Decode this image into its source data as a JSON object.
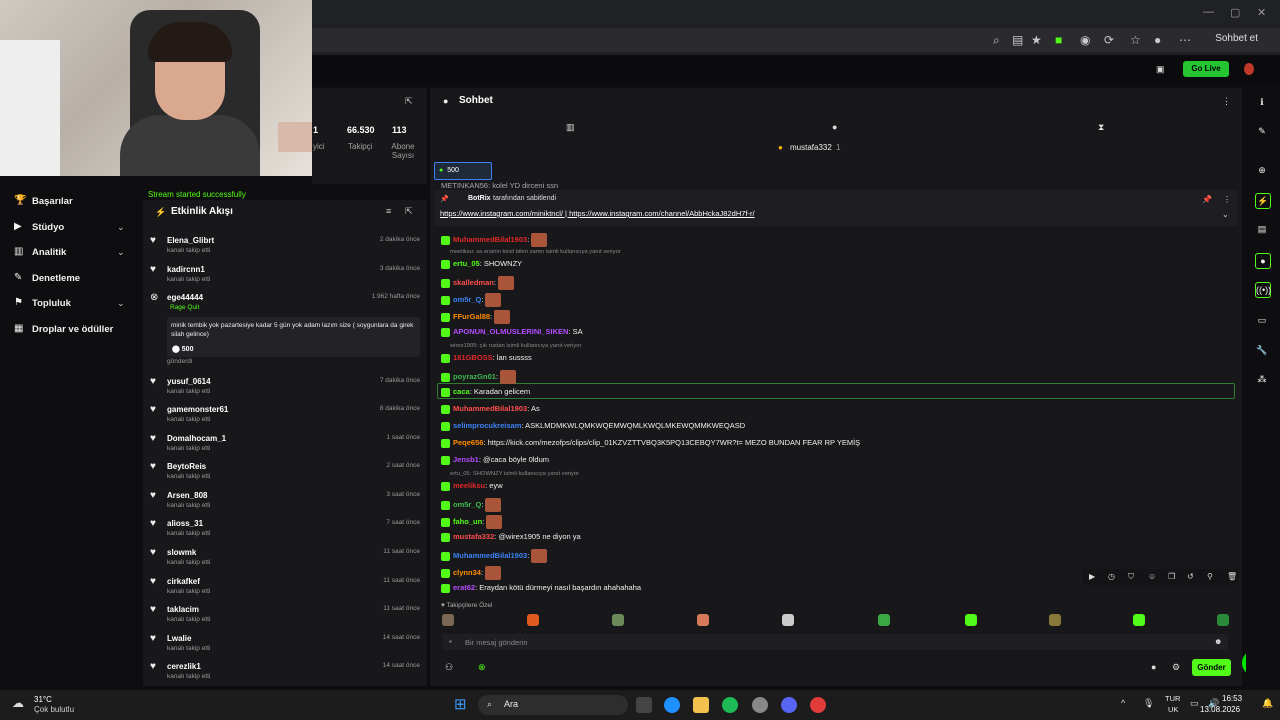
{
  "browser": {
    "sohbet_et": "Sohbet et"
  },
  "header": {
    "go_live": "Go Live"
  },
  "nav": {
    "items": [
      {
        "label": "Başarılar"
      },
      {
        "label": "Stüdyo"
      },
      {
        "label": "Analitik"
      },
      {
        "label": "Denetleme"
      },
      {
        "label": "Topluluk"
      },
      {
        "label": "Droplar ve ödüller"
      }
    ]
  },
  "stats": {
    "followers_value": "66.530",
    "followers_label": "Takipçi",
    "subs_value": "113",
    "subs_label": "Abone Sayısı",
    "viewers_label": "İzleyici"
  },
  "activity": {
    "stream_ok": "Stream started successfully",
    "title": "Etkinlik Akışı",
    "rows": [
      {
        "user": "Elena_Glibrt",
        "sub": "kanalı takip etti",
        "time": "2 dakika önce"
      },
      {
        "user": "kadircnn1",
        "sub": "kanalı takip etti",
        "time": "3 dakika önce"
      },
      {
        "user": "ege44444",
        "sub": "Rage Quit",
        "time": "1.962 hafta önce"
      },
      {
        "user": "yusuf_0614",
        "sub": "kanalı takip etti",
        "time": "7 dakika önce"
      },
      {
        "user": "gamemonster61",
        "sub": "kanalı takip etti",
        "time": "8 dakika önce"
      },
      {
        "user": "Domalhocam_1",
        "sub": "kanalı takip etti",
        "time": "1 saat önce"
      },
      {
        "user": "BeytoReis",
        "sub": "kanalı takip etti",
        "time": "2 saat önce"
      },
      {
        "user": "Arsen_808",
        "sub": "kanalı takip etti",
        "time": "3 saat önce"
      },
      {
        "user": "alioss_31",
        "sub": "kanalı takip etti",
        "time": "7 saat önce"
      },
      {
        "user": "slowmk",
        "sub": "kanalı takip etti",
        "time": "11 saat önce"
      },
      {
        "user": "cirkafkef",
        "sub": "kanalı takip etti",
        "time": "11 saat önce"
      },
      {
        "user": "taklacim",
        "sub": "kanalı takip etti",
        "time": "11 saat önce"
      },
      {
        "user": "Lwalie",
        "sub": "kanalı takip etti",
        "time": "14 saat önce"
      },
      {
        "user": "cerezlik1",
        "sub": "kanalı takip etti",
        "time": "14 saat önce"
      }
    ],
    "gift_message": "minik tembik yok pazartesiye kadar 5 gün yok adam lazım size ( soygunlara da girek silah gelince)",
    "gift_amount": "500",
    "gift_sent": "gönderdi"
  },
  "chat": {
    "title": "Sohbet",
    "top_user": "mustafa332",
    "top_count": "1",
    "gift_badge": "500",
    "pinned_by": "BotRix",
    "pinned_by_suffix": "tarafından sabitlendi",
    "pinned_links": "https://www.instagram.com/miniktncl/ | https://www.instagram.com/channel/AbbHckaJ82dH7f-r/",
    "cut_top": "METINKAN56: kolel YD dirceni ssn",
    "messages": [
      {
        "user": "MuhammedBilal1903",
        "text": ":"
      },
      {
        "reply": "meeliksu: sa ersinin kicel bilen varmı isimli kullanıcıya yanıt veriyor"
      },
      {
        "user": "ertu_05",
        "text": ": SHOWNZY"
      },
      {
        "user": "skalledman",
        "text": ":"
      },
      {
        "user": "om5r_Q",
        "text": ":"
      },
      {
        "user": "FFurGal88",
        "text": ":"
      },
      {
        "user": "APONUN_OLMUSLERINI_SIKEN",
        "text": ": SA"
      },
      {
        "reply": "wirex1905: çık rustan isimli kullanıcıya yanıt veriyor"
      },
      {
        "user": "181GBOSS",
        "text": ": lan sussss"
      },
      {
        "user": "poyrazGn01",
        "text": ":"
      },
      {
        "user": "caca",
        "text": ": Karadan gelicem"
      },
      {
        "user": "MuhammedBilal1903",
        "text": ": As"
      },
      {
        "user": "selimprocukreisam",
        "text": ": ASKLMDMKWLQMKWQEMWQMLKWQLMKEWQMMKWEQASD"
      },
      {
        "user": "Peqe656",
        "text": ": https://kick.com/mezofps/clips/clip_01KZVZTTVBQ3K5PQ13CEBQY7WR?t= MEZO BUNDAN FEAR RP YEMİŞ"
      },
      {
        "user": "Jensb1",
        "text": ": @caca  böyle 0ldum"
      },
      {
        "reply": "ertu_05: SHOWNZY isimli kullanıcıya yanıt veriyor"
      },
      {
        "user": "meeliksu",
        "text": ": eyw"
      },
      {
        "user": "om5r_Q",
        "text": ":"
      },
      {
        "user": "faho_un",
        "text": ":"
      },
      {
        "user": "mustafa332",
        "text": ": @wirex1905 ne diyon ya"
      },
      {
        "user": "MuhammedBilal1903",
        "text": ":"
      },
      {
        "user": "clynn34",
        "text": ":"
      },
      {
        "user": "erat62",
        "text": ": Eraydan kötü dürmeyi nasıl başardın ahahahaha"
      }
    ],
    "followers_special": "Takipçilere Özel",
    "input_placeholder": "Bir mesaj gönderin",
    "send": "Gönder"
  },
  "taskbar": {
    "weather_temp": "31°C",
    "weather_desc": "Çok bulutlu",
    "search": "Ara",
    "lang1": "TUR",
    "lang2": "UK",
    "time": "16:53",
    "date": "13.08.2026"
  },
  "colors": {
    "kick_green": "#53fc18",
    "bg": "#0e0e10",
    "panel": "#18181b"
  }
}
